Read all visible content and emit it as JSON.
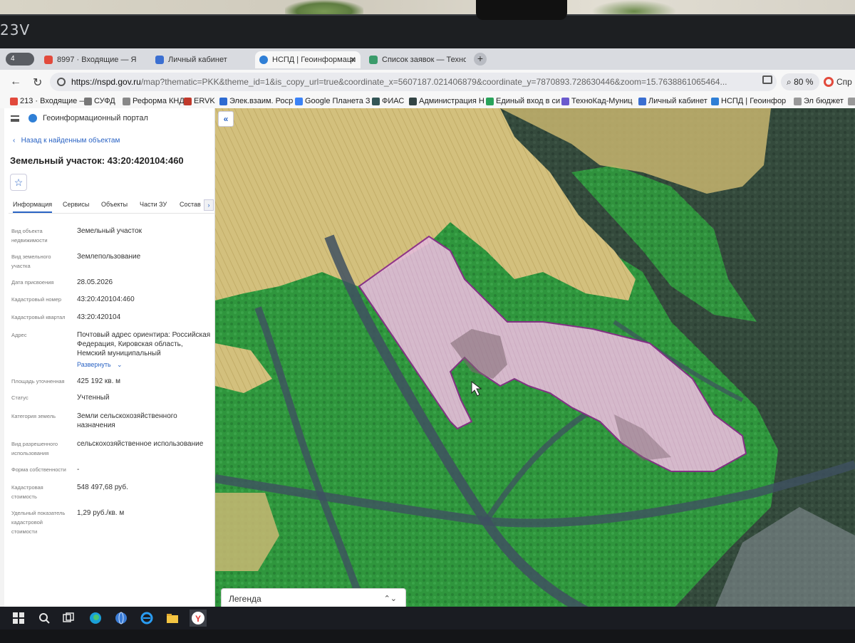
{
  "monitor": {
    "label": "23V"
  },
  "browser": {
    "tab_count": "4",
    "tabs": [
      {
        "label": "8997 · Входящие — Янд",
        "color": "#e24a3c"
      },
      {
        "label": "Личный кабинет",
        "color": "#3b6fd1"
      },
      {
        "label": "НСПД | Геоинформаци",
        "color": "#2f7fd6",
        "active": true
      },
      {
        "label": "Список заявок — Техно",
        "color": "#3a9b6b"
      }
    ],
    "url_host": "https://nspd.gov.ru",
    "url_rest": "/map?thematic=PKK&theme_id=1&is_copy_url=true&coordinate_x=5607187.021406879&coordinate_y=7870893.728630446&zoom=15.7638861065464...",
    "zoom": "80 %",
    "profile": "Спр",
    "bookmarks": [
      {
        "label": "213 · Входящие —",
        "color": "#e24a3c"
      },
      {
        "label": "СУФД",
        "color": "#777"
      },
      {
        "label": "Реформа КНД",
        "color": "#888"
      },
      {
        "label": "ERVK",
        "color": "#c0392b"
      },
      {
        "label": "Элек.взаим. Роср",
        "color": "#2e6bd1"
      },
      {
        "label": "Google Планета З",
        "color": "#3b82f6"
      },
      {
        "label": "ФИАС",
        "color": "#355"
      },
      {
        "label": "Администрация Н",
        "color": "#344"
      },
      {
        "label": "Единый вход в си",
        "color": "#2aa35a"
      },
      {
        "label": "ТехноКад-Муниц",
        "color": "#6a5acd"
      },
      {
        "label": "Личный кабинет",
        "color": "#3b6fd1"
      },
      {
        "label": "НСПД | Геоинфор",
        "color": "#2f7fd6"
      },
      {
        "label": "Эл бюджет",
        "color": "#999"
      },
      {
        "label": "У",
        "color": "#999"
      }
    ]
  },
  "sidebar": {
    "portal_title": "Геоинформационный портал",
    "back": "Назад к найденным объектам",
    "title": "Земельный участок: 43:20:420104:460",
    "tabs": [
      "Информация",
      "Сервисы",
      "Объекты",
      "Части ЗУ",
      "Состав"
    ],
    "expand_label": "Развернуть",
    "props": [
      {
        "key": "Вид объекта недвижимости",
        "value": "Земельный участок"
      },
      {
        "key": "Вид земельного участка",
        "value": "Землепользование"
      },
      {
        "key": "Дата присвоения",
        "value": "28.05.2026"
      },
      {
        "key": "Кадастровый номер",
        "value": "43:20:420104:460"
      },
      {
        "key": "Кадастровый квартал",
        "value": "43:20:420104"
      },
      {
        "key": "Адрес",
        "value": "Почтовый адрес ориентира: Российская Федерация, Кировская область, Немский муниципальный"
      },
      {
        "key": "Площадь уточненная",
        "value": "425 192 кв. м"
      },
      {
        "key": "Статус",
        "value": "Учтенный"
      },
      {
        "key": "Категория земель",
        "value": "Земли сельскохозяйственного назначения"
      },
      {
        "key": "Вид разрешенного использования",
        "value": "сельскохозяйственное использование"
      },
      {
        "key": "Форма собственности",
        "value": "-"
      },
      {
        "key": "Кадастровая стоимость",
        "value": "548 497,68 руб."
      },
      {
        "key": "Удельный показатель кадастровой стоимости",
        "value": "1,29 руб./кв. м"
      }
    ]
  },
  "map": {
    "collapse_label": "«",
    "legend_label": "Легенда",
    "legend_arrow": "⌃⌄",
    "colors": {
      "field": "#cdbb77",
      "forest": "#2f9a3d",
      "parcel_fill": "#e2b7d6",
      "parcel_border": "#8a2a8a",
      "river": "#3f5060"
    }
  }
}
